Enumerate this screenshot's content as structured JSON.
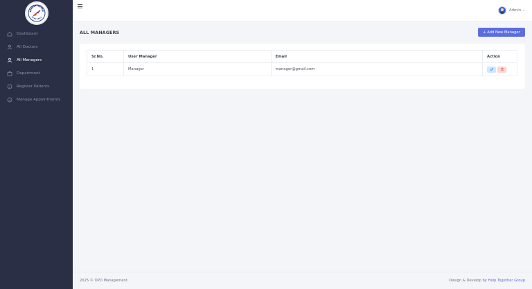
{
  "sidebar": {
    "logo_icon": "clinic-logo",
    "items": [
      {
        "label": "Dashboard",
        "icon": "home-icon",
        "active": false
      },
      {
        "label": "All Doctors",
        "icon": "user-icon",
        "active": false
      },
      {
        "label": "All Managers",
        "icon": "user-icon",
        "active": true
      },
      {
        "label": "Department",
        "icon": "briefcase-icon",
        "active": false
      },
      {
        "label": "Register Patients",
        "icon": "smile-icon",
        "active": false
      },
      {
        "label": "Manage Appointments",
        "icon": "smile-icon",
        "active": false
      }
    ]
  },
  "topbar": {
    "menu_icon": "hamburger-icon",
    "user_name": "Admin",
    "user_caret": "⌄"
  },
  "main": {
    "title": "ALL MANAGERS",
    "add_button_label": "+ Add New Manager",
    "table": {
      "headers": [
        "Sr.No.",
        "User Manager",
        "Email",
        "Action"
      ],
      "rows": [
        {
          "sr": "1",
          "name": "Manager",
          "email": "manager@gmail.com"
        }
      ]
    }
  },
  "footer": {
    "copyright": "2025 © OPD Management.",
    "credit_prefix": "Design & Develop by ",
    "credit_link": "Help Together Group"
  },
  "colors": {
    "sidebar_bg": "#2a2f45",
    "accent": "#5a6ee0",
    "edit_bg": "#cfe8ff",
    "delete_bg": "#ffd6d6"
  }
}
